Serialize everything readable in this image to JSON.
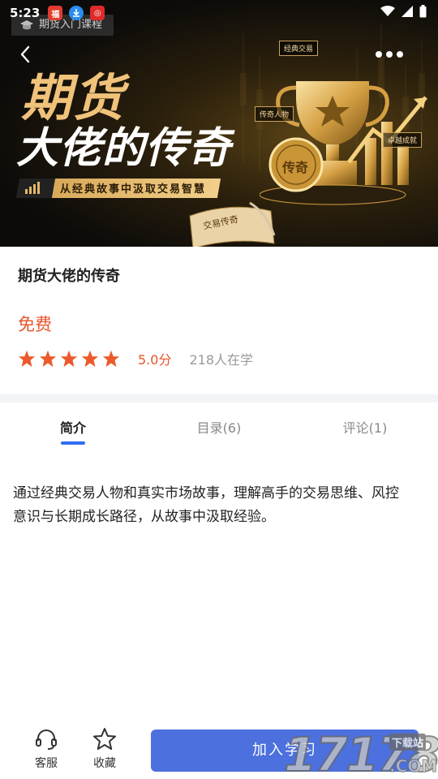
{
  "status_bar": {
    "time": "5:23"
  },
  "hero": {
    "course_tag": "期货入门课程",
    "title_line1": "期货",
    "title_line2": "大佬的传奇",
    "subtitle": "从经典故事中汲取交易智慧",
    "labels": {
      "classic": "经典交易",
      "legend": "传奇人物",
      "success": "卓越成就",
      "coin": "传奇",
      "scroll": "交易传奇"
    }
  },
  "course": {
    "name": "期货大佬的传奇",
    "price": "免费",
    "rating_stars": 5,
    "score": "5.0分",
    "learners": "218人在学"
  },
  "tabs": [
    {
      "label": "简介",
      "active": true
    },
    {
      "label": "目录(6)",
      "active": false
    },
    {
      "label": "评论(1)",
      "active": false
    }
  ],
  "description": "通过经典交易人物和真实市场故事，理解高手的交易思维、风控意识与长期成长路径，从故事中汲取经验。",
  "bottom": {
    "service_label": "客服",
    "favorite_label": "收藏",
    "join_label": "加入学习"
  },
  "watermark": {
    "number": "17178",
    "suffix": ".COM",
    "badge": "下载站"
  },
  "colors": {
    "accent": "#e7532a",
    "primary": "#4c70dd",
    "tab_indicator": "#2f6cf2",
    "gold": "#f0c27a"
  }
}
